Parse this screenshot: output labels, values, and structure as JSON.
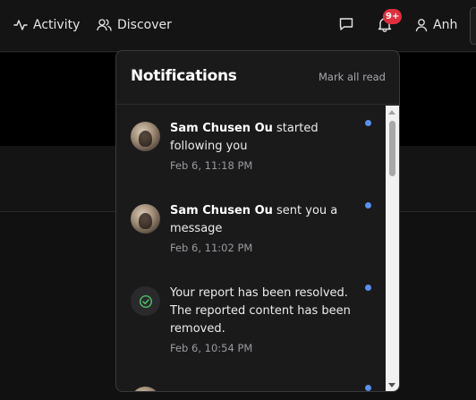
{
  "nav": {
    "activity_label": "Activity",
    "discover_label": "Discover",
    "notification_badge": "9+",
    "user_label": "Anh"
  },
  "popup": {
    "title": "Notifications",
    "mark_all_read": "Mark all read"
  },
  "notifications": [
    {
      "actor": "Sam Chusen Ou",
      "text": " started following you",
      "time": "Feb 6, 11:18 PM",
      "unread": true,
      "icon": "avatar"
    },
    {
      "actor": "Sam Chusen Ou",
      "text": " sent you a message",
      "time": "Feb 6, 11:02 PM",
      "unread": true,
      "icon": "avatar"
    },
    {
      "actor": "",
      "text": "Your report has been resolved. The reported content has been removed.",
      "time": "Feb 6, 10:54 PM",
      "unread": true,
      "icon": "check-circle-icon"
    },
    {
      "actor": "",
      "text": "",
      "time": "",
      "unread": true,
      "icon": "avatar"
    }
  ],
  "colors": {
    "accent_unread": "#5a8ff0",
    "badge": "#e0303c"
  }
}
